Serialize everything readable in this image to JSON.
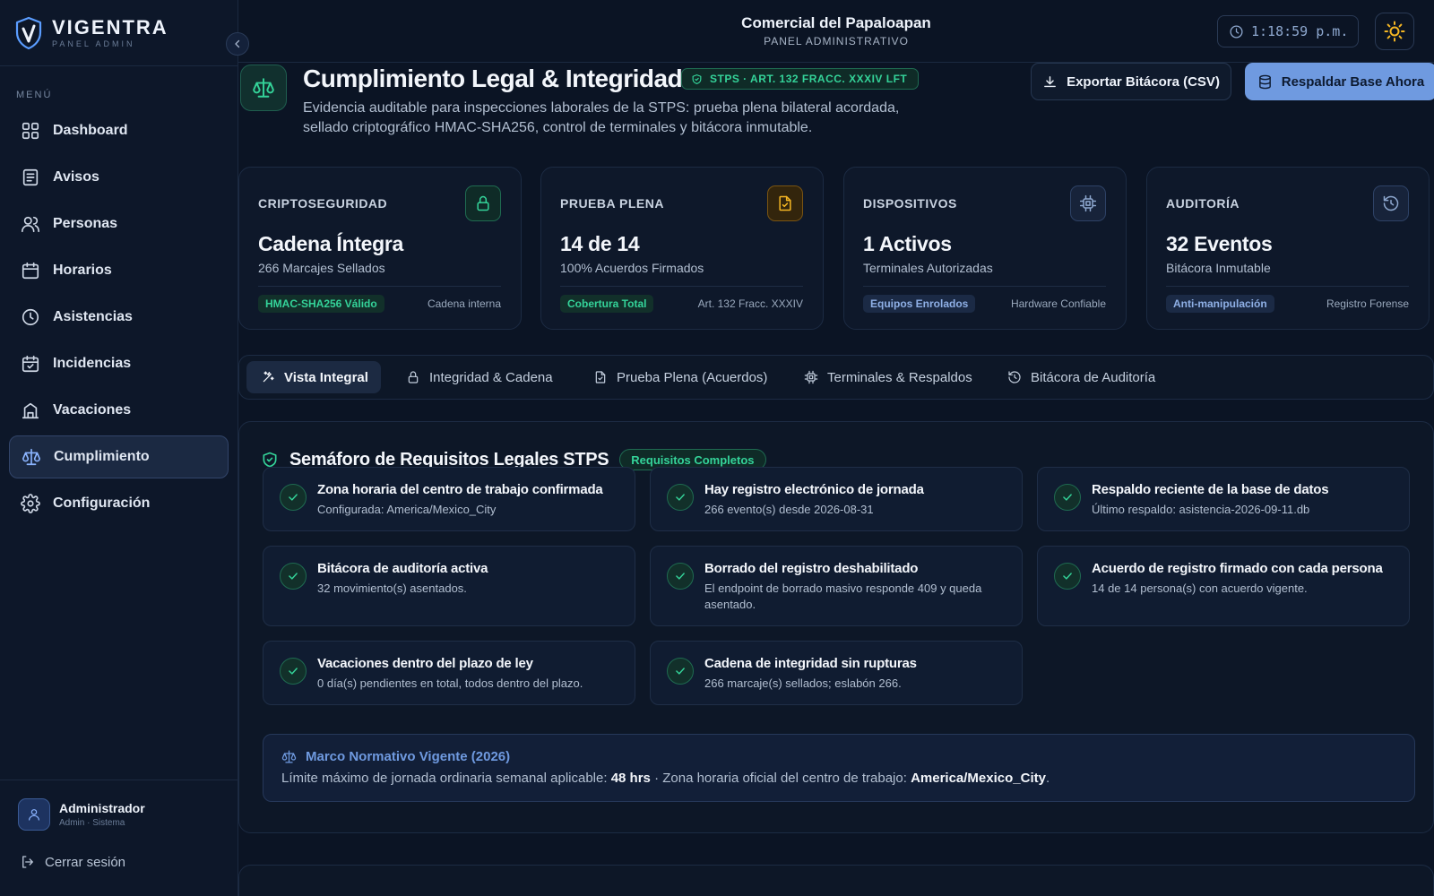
{
  "brand": {
    "name": "VIGENTRA",
    "subtitle": "PANEL ADMIN"
  },
  "sidebar": {
    "menu_label": "MENÚ",
    "items": [
      {
        "label": "Dashboard",
        "icon": "grid-icon"
      },
      {
        "label": "Avisos",
        "icon": "notice-icon"
      },
      {
        "label": "Personas",
        "icon": "users-icon"
      },
      {
        "label": "Horarios",
        "icon": "calendar-icon"
      },
      {
        "label": "Asistencias",
        "icon": "clock-icon"
      },
      {
        "label": "Incidencias",
        "icon": "calendar-check-icon"
      },
      {
        "label": "Vacaciones",
        "icon": "beach-icon"
      },
      {
        "label": "Cumplimiento",
        "icon": "scale-icon",
        "active": true
      },
      {
        "label": "Configuración",
        "icon": "gear-icon"
      }
    ],
    "user": {
      "name": "Administrador",
      "role": "Admin · Sistema"
    },
    "logout_label": "Cerrar sesión"
  },
  "header": {
    "company_name": "Comercial del Papaloapan",
    "company_subtitle": "PANEL ADMINISTRATIVO",
    "clock": "1:18:59 p.m."
  },
  "page": {
    "title": "Cumplimiento Legal & Integridad",
    "badge": "STPS · ART. 132 FRACC. XXXIV LFT",
    "description": "Evidencia auditable para inspecciones laborales de la STPS: prueba plena bilateral acordada, sellado criptográfico HMAC-SHA256, control de terminales y bitácora inmutable.",
    "export_label": "Exportar Bitácora (CSV)",
    "backup_label": "Respaldar Base Ahora"
  },
  "stats": [
    {
      "label": "CRIPTOSEGURIDAD",
      "value": "Cadena Íntegra",
      "sub": "266 Marcajes Sellados",
      "pill": "HMAC-SHA256 Válido",
      "note": "Cadena interna",
      "icon": "lock-icon",
      "color": "#34d399"
    },
    {
      "label": "PRUEBA PLENA",
      "value": "14 de 14",
      "sub": "100% Acuerdos Firmados",
      "pill": "Cobertura Total",
      "note": "Art. 132 Fracc. XXXIV",
      "icon": "file-check-icon",
      "color": "#f5b623"
    },
    {
      "label": "DISPOSITIVOS",
      "value": "1 Activos",
      "sub": "Terminales Autorizadas",
      "pill": "Equipos Enrolados",
      "note": "Hardware Confiable",
      "icon": "chip-icon",
      "color": "#8ea8cf"
    },
    {
      "label": "AUDITORÍA",
      "value": "32 Eventos",
      "sub": "Bitácora Inmutable",
      "pill": "Anti-manipulación",
      "note": "Registro Forense",
      "icon": "history-icon",
      "color": "#8ea8cf"
    }
  ],
  "tabs": [
    {
      "label": "Vista Integral",
      "active": true
    },
    {
      "label": "Integridad & Cadena"
    },
    {
      "label": "Prueba Plena (Acuerdos)"
    },
    {
      "label": "Terminales & Respaldos"
    },
    {
      "label": "Bitácora de Auditoría"
    }
  ],
  "semaforo": {
    "title": "Semáforo de Requisitos Legales STPS",
    "badge": "Requisitos Completos",
    "items": [
      {
        "title": "Zona horaria del centro de trabajo confirmada",
        "desc": "Configurada: America/Mexico_City"
      },
      {
        "title": "Hay registro electrónico de jornada",
        "desc": "266 evento(s) desde 2026-08-31"
      },
      {
        "title": "Respaldo reciente de la base de datos",
        "desc": "Último respaldo: asistencia-2026-09-11.db"
      },
      {
        "title": "Bitácora de auditoría activa",
        "desc": "32 movimiento(s) asentados."
      },
      {
        "title": "Borrado del registro deshabilitado",
        "desc": "El endpoint de borrado masivo responde 409 y queda asentado."
      },
      {
        "title": "Acuerdo de registro firmado con cada persona",
        "desc": "14 de 14 persona(s) con acuerdo vigente."
      },
      {
        "title": "Vacaciones dentro del plazo de ley",
        "desc": "0 día(s) pendientes en total, todos dentro del plazo."
      },
      {
        "title": "Cadena de integridad sin rupturas",
        "desc": "266 marcaje(s) sellados; eslabón 266."
      }
    ]
  },
  "marco": {
    "title": "Marco Normativo Vigente (2026)",
    "text_prefix": "Límite máximo de jornada ordinaria semanal aplicable: ",
    "hours": "48 hrs",
    "text_middle": " · Zona horaria oficial del centro de trabajo: ",
    "timezone": "America/Mexico_City",
    "text_suffix": "."
  }
}
